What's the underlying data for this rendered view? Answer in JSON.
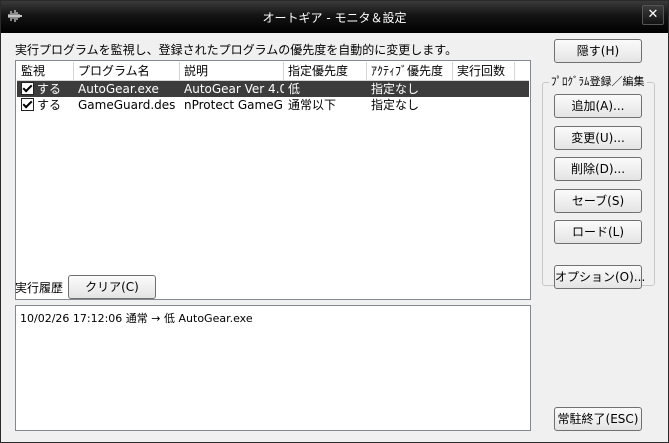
{
  "window": {
    "title": "オートギア - モニタ＆設定",
    "close_glyph": "✕"
  },
  "description": "実行プログラムを監視し、登録されたプログラムの優先度を自動的に変更します。",
  "list": {
    "columns": [
      "監視",
      "プログラム名",
      "説明",
      "指定優先度",
      "ｱｸﾃｨﾌﾞ優先度",
      "実行回数"
    ],
    "rows": [
      {
        "monitor": "する",
        "checked": true,
        "program": "AutoGear.exe",
        "description": "AutoGear Ver 4.0",
        "priority": "低",
        "active_priority": "指定なし",
        "count": "",
        "selected": true
      },
      {
        "monitor": "する",
        "checked": true,
        "program": "GameGuard.des",
        "description": "nProtect GameG...",
        "priority": "通常以下",
        "active_priority": "指定なし",
        "count": "",
        "selected": false
      }
    ]
  },
  "buttons": {
    "hide": "隠す(H)",
    "add": "追加(A)...",
    "edit": "変更(U)...",
    "delete": "削除(D)...",
    "save": "セーブ(S)",
    "load": "ロード(L)",
    "options": "オプション(O)...",
    "exit": "常駐終了(ESC)",
    "clear": "クリア(C)"
  },
  "group_label": "ﾌﾟﾛｸﾞﾗﾑ登録／編集",
  "history": {
    "label": "実行履歴",
    "entries": [
      "10/02/26 17:12:06 通常 → 低 AutoGear.exe"
    ]
  },
  "colors": {
    "selection": "#3c3c3c",
    "titlebar": "#000000"
  }
}
